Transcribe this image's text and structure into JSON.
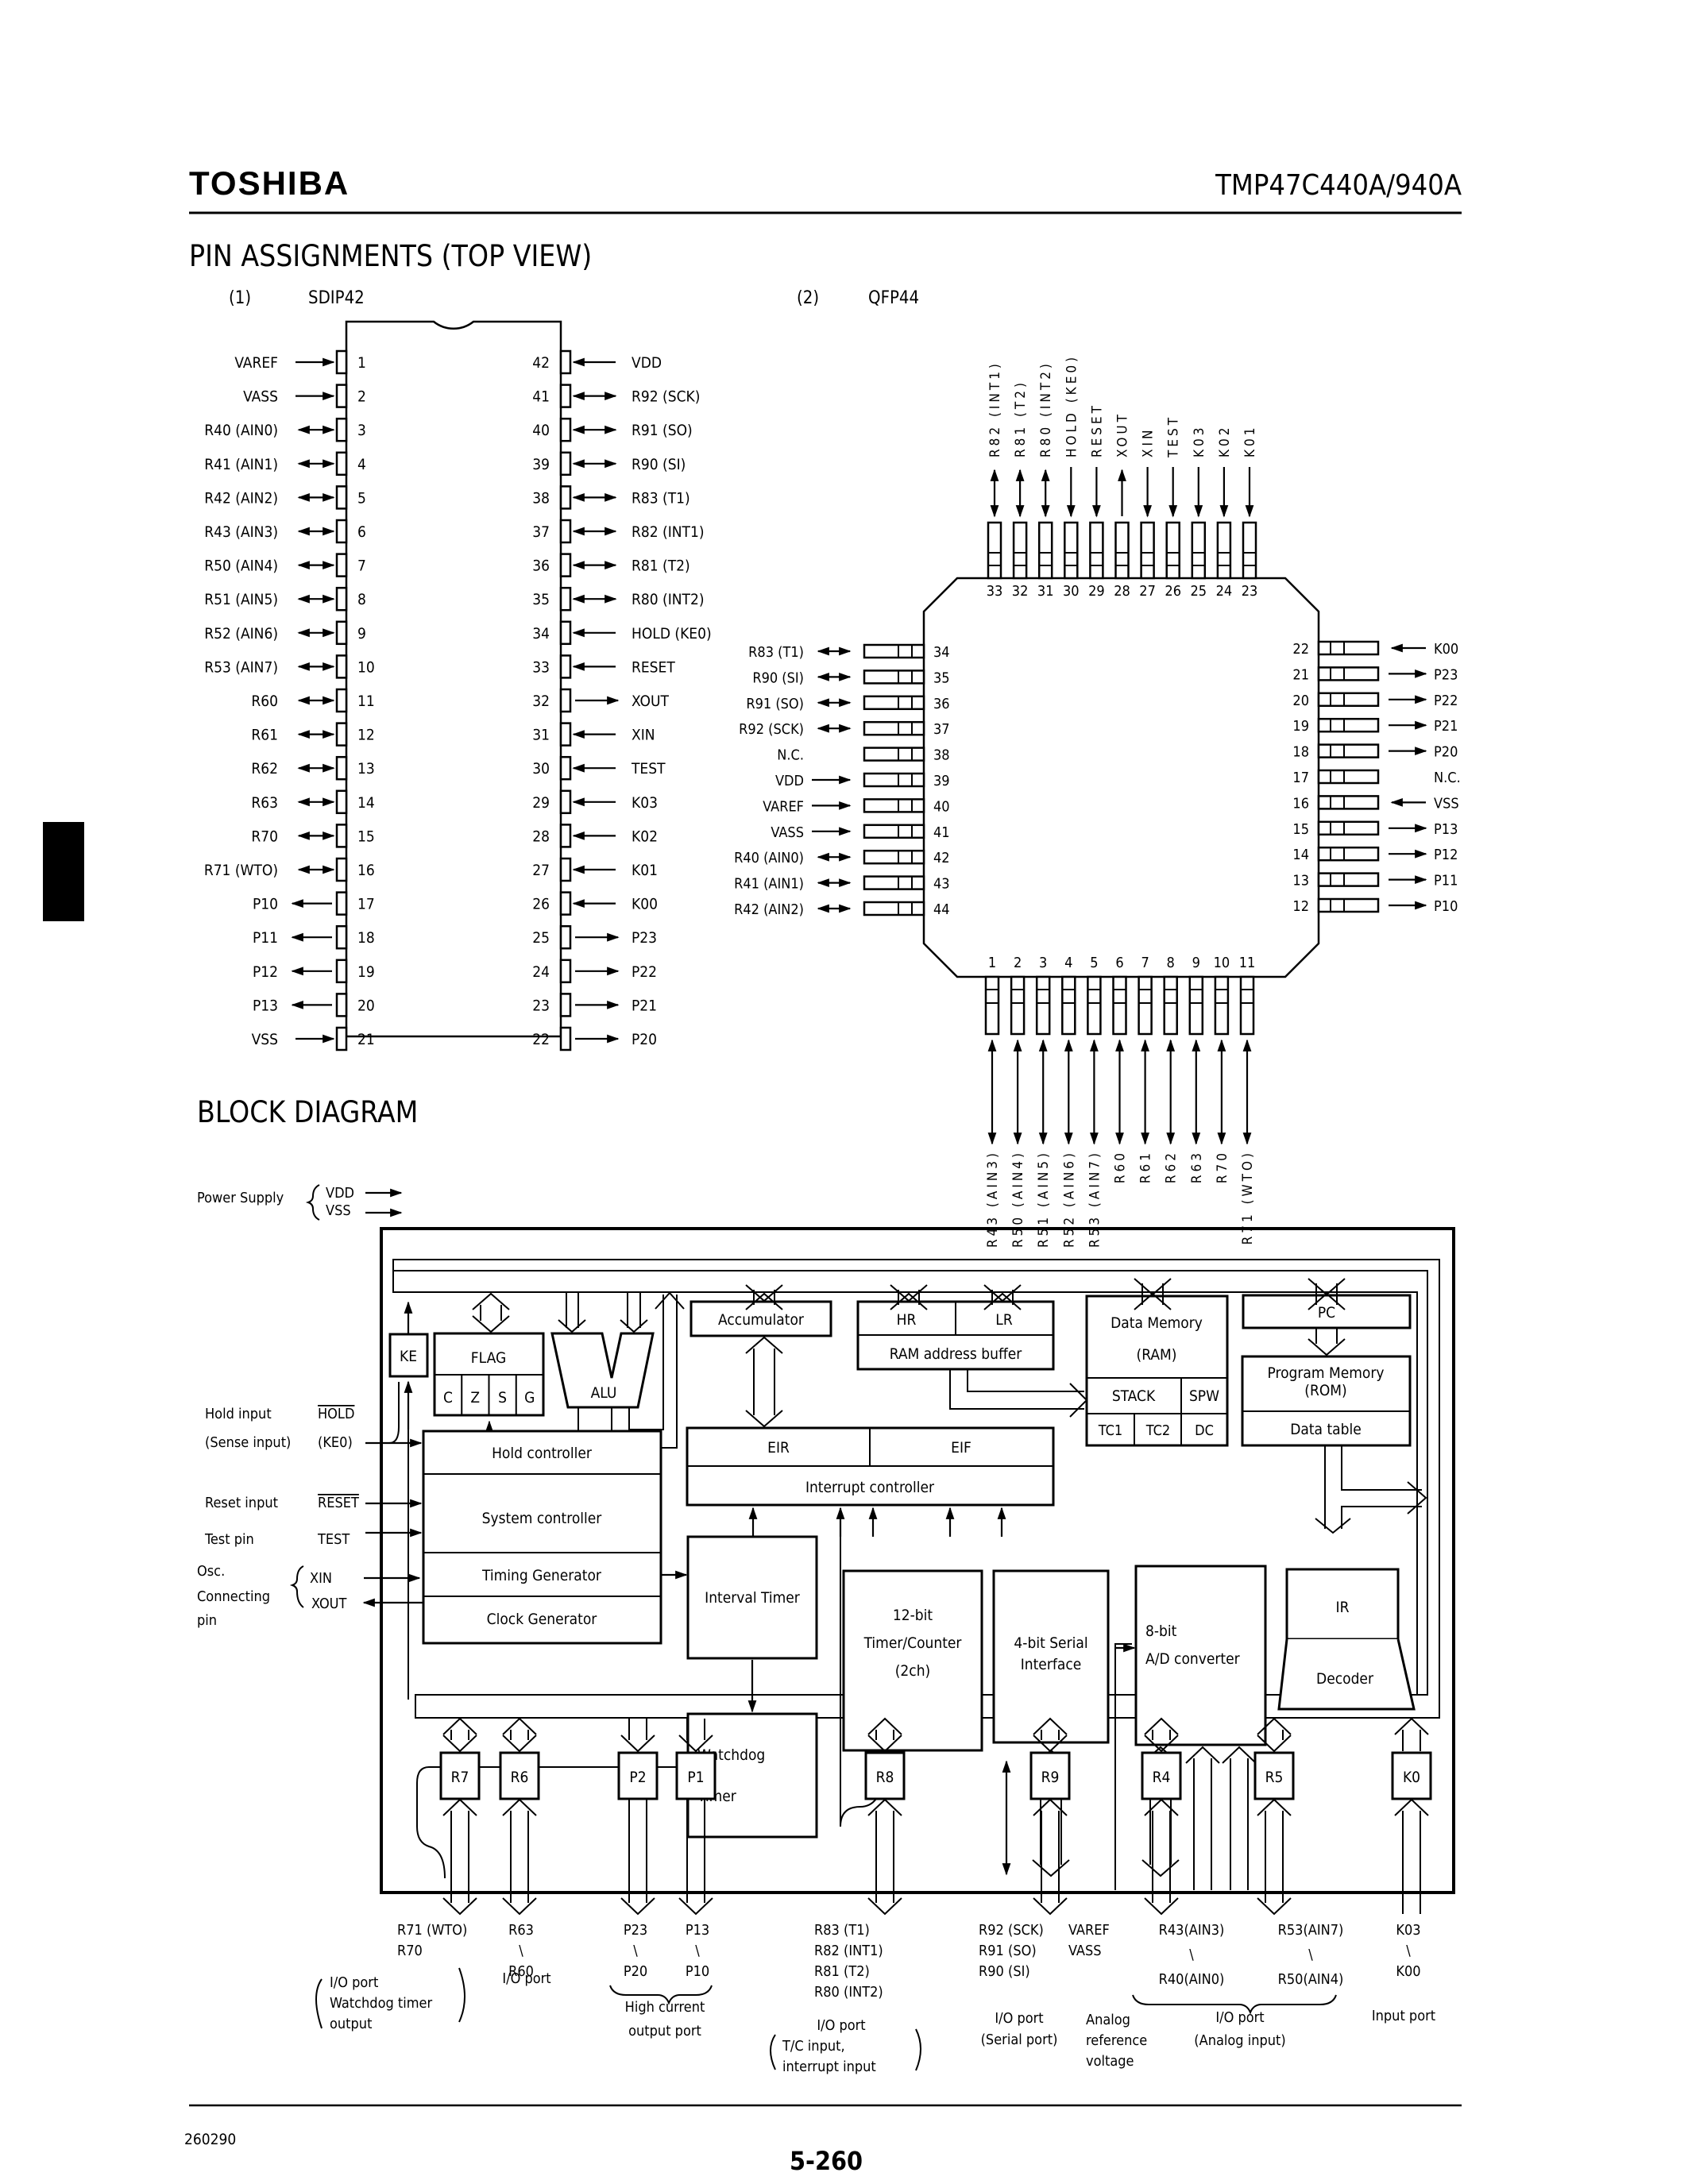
{
  "header": {
    "brand": "TOSHIBA",
    "part_number": "TMP47C440A/940A"
  },
  "pin_section": {
    "title": "PIN ASSIGNMENTS (TOP VIEW)",
    "sdip": {
      "index": "(1)",
      "name": "SDIP42",
      "left_pins": [
        {
          "num": "1",
          "label": "VAREF",
          "dir": "in"
        },
        {
          "num": "2",
          "label": "VASS",
          "dir": "in"
        },
        {
          "num": "3",
          "label": "R40 (AIN0)",
          "dir": "bi"
        },
        {
          "num": "4",
          "label": "R41 (AIN1)",
          "dir": "bi"
        },
        {
          "num": "5",
          "label": "R42 (AIN2)",
          "dir": "bi"
        },
        {
          "num": "6",
          "label": "R43 (AIN3)",
          "dir": "bi"
        },
        {
          "num": "7",
          "label": "R50 (AIN4)",
          "dir": "bi"
        },
        {
          "num": "8",
          "label": "R51 (AIN5)",
          "dir": "bi"
        },
        {
          "num": "9",
          "label": "R52 (AIN6)",
          "dir": "bi"
        },
        {
          "num": "10",
          "label": "R53 (AIN7)",
          "dir": "bi"
        },
        {
          "num": "11",
          "label": "R60",
          "dir": "bi"
        },
        {
          "num": "12",
          "label": "R61",
          "dir": "bi"
        },
        {
          "num": "13",
          "label": "R62",
          "dir": "bi"
        },
        {
          "num": "14",
          "label": "R63",
          "dir": "bi"
        },
        {
          "num": "15",
          "label": "R70",
          "dir": "bi"
        },
        {
          "num": "16",
          "label": "R71 (WTO)",
          "dir": "bi"
        },
        {
          "num": "17",
          "label": "P10",
          "dir": "out"
        },
        {
          "num": "18",
          "label": "P11",
          "dir": "out"
        },
        {
          "num": "19",
          "label": "P12",
          "dir": "out"
        },
        {
          "num": "20",
          "label": "P13",
          "dir": "out"
        },
        {
          "num": "21",
          "label": "VSS",
          "dir": "in"
        }
      ],
      "right_pins": [
        {
          "num": "42",
          "label": "VDD",
          "dir": "in"
        },
        {
          "num": "41",
          "label": "R92 (SCK)",
          "dir": "bi"
        },
        {
          "num": "40",
          "label": "R91 (SO)",
          "dir": "bi"
        },
        {
          "num": "39",
          "label": "R90 (SI)",
          "dir": "bi"
        },
        {
          "num": "38",
          "label": "R83 (T1)",
          "dir": "bi"
        },
        {
          "num": "37",
          "label": "R82 (INT1)",
          "dir": "bi"
        },
        {
          "num": "36",
          "label": "R81 (T2)",
          "dir": "bi"
        },
        {
          "num": "35",
          "label": "R80 (INT2)",
          "dir": "bi"
        },
        {
          "num": "34",
          "label": "HOLD (KE0)",
          "dir": "in"
        },
        {
          "num": "33",
          "label": "RESET",
          "dir": "in"
        },
        {
          "num": "32",
          "label": "XOUT",
          "dir": "out"
        },
        {
          "num": "31",
          "label": "XIN",
          "dir": "in"
        },
        {
          "num": "30",
          "label": "TEST",
          "dir": "in"
        },
        {
          "num": "29",
          "label": "K03",
          "dir": "in"
        },
        {
          "num": "28",
          "label": "K02",
          "dir": "in"
        },
        {
          "num": "27",
          "label": "K01",
          "dir": "in"
        },
        {
          "num": "26",
          "label": "K00",
          "dir": "in"
        },
        {
          "num": "25",
          "label": "P23",
          "dir": "out"
        },
        {
          "num": "24",
          "label": "P22",
          "dir": "out"
        },
        {
          "num": "23",
          "label": "P21",
          "dir": "out"
        },
        {
          "num": "22",
          "label": "P20",
          "dir": "out"
        }
      ]
    },
    "qfp": {
      "index": "(2)",
      "name": "QFP44",
      "top_pins": [
        {
          "num": "33",
          "label": "R82 (INT1)",
          "dir": "bi"
        },
        {
          "num": "32",
          "label": "R81 (T2)",
          "dir": "bi"
        },
        {
          "num": "31",
          "label": "R80 (INT2)",
          "dir": "bi"
        },
        {
          "num": "30",
          "label": "HOLD (KE0)",
          "dir": "in"
        },
        {
          "num": "29",
          "label": "RESET",
          "dir": "in"
        },
        {
          "num": "28",
          "label": "XOUT",
          "dir": "out"
        },
        {
          "num": "27",
          "label": "XIN",
          "dir": "in"
        },
        {
          "num": "26",
          "label": "TEST",
          "dir": "in"
        },
        {
          "num": "25",
          "label": "K03",
          "dir": "in"
        },
        {
          "num": "24",
          "label": "K02",
          "dir": "in"
        },
        {
          "num": "23",
          "label": "K01",
          "dir": "in"
        }
      ],
      "left_pins": [
        {
          "num": "34",
          "label": "R83 (T1)",
          "dir": "bi"
        },
        {
          "num": "35",
          "label": "R90 (SI)",
          "dir": "bi"
        },
        {
          "num": "36",
          "label": "R91 (SO)",
          "dir": "bi"
        },
        {
          "num": "37",
          "label": "R92 (SCK)",
          "dir": "bi"
        },
        {
          "num": "38",
          "label": "N.C.",
          "dir": "none"
        },
        {
          "num": "39",
          "label": "VDD",
          "dir": "in"
        },
        {
          "num": "40",
          "label": "VAREF",
          "dir": "in"
        },
        {
          "num": "41",
          "label": "VASS",
          "dir": "in"
        },
        {
          "num": "42",
          "label": "R40 (AIN0)",
          "dir": "bi"
        },
        {
          "num": "43",
          "label": "R41 (AIN1)",
          "dir": "bi"
        },
        {
          "num": "44",
          "label": "R42 (AIN2)",
          "dir": "bi"
        }
      ],
      "right_pins": [
        {
          "num": "22",
          "label": "K00",
          "dir": "in"
        },
        {
          "num": "21",
          "label": "P23",
          "dir": "out"
        },
        {
          "num": "20",
          "label": "P22",
          "dir": "out"
        },
        {
          "num": "19",
          "label": "P21",
          "dir": "out"
        },
        {
          "num": "18",
          "label": "P20",
          "dir": "out"
        },
        {
          "num": "17",
          "label": "N.C.",
          "dir": "none"
        },
        {
          "num": "16",
          "label": "VSS",
          "dir": "in"
        },
        {
          "num": "15",
          "label": "P13",
          "dir": "out"
        },
        {
          "num": "14",
          "label": "P12",
          "dir": "out"
        },
        {
          "num": "13",
          "label": "P11",
          "dir": "out"
        },
        {
          "num": "12",
          "label": "P10",
          "dir": "out"
        }
      ],
      "bottom_pins": [
        {
          "num": "1",
          "label": "R43 (AIN3)",
          "dir": "bi"
        },
        {
          "num": "2",
          "label": "R50 (AIN4)",
          "dir": "bi"
        },
        {
          "num": "3",
          "label": "R51 (AIN5)",
          "dir": "bi"
        },
        {
          "num": "4",
          "label": "R52 (AIN6)",
          "dir": "bi"
        },
        {
          "num": "5",
          "label": "R53 (AIN7)",
          "dir": "bi"
        },
        {
          "num": "6",
          "label": "R60",
          "dir": "bi"
        },
        {
          "num": "7",
          "label": "R61",
          "dir": "bi"
        },
        {
          "num": "8",
          "label": "R62",
          "dir": "bi"
        },
        {
          "num": "9",
          "label": "R63",
          "dir": "bi"
        },
        {
          "num": "10",
          "label": "R70",
          "dir": "bi"
        },
        {
          "num": "11",
          "label": "R71 (WTO)",
          "dir": "bi"
        }
      ]
    }
  },
  "block_diagram": {
    "title": "BLOCK DIAGRAM",
    "inputs": {
      "power_supply": "Power Supply",
      "vdd": "VDD",
      "vss": "VSS",
      "hold_input": "Hold input",
      "hold": "HOLD",
      "sense_input": "(Sense input)",
      "ke0": "(KE0)",
      "reset_input": "Reset input",
      "reset": "RESET",
      "test_pin": "Test pin",
      "test": "TEST",
      "osc1": "Osc.",
      "osc2": "Connecting",
      "osc3": "pin",
      "xin": "XIN",
      "xout": "XOUT"
    },
    "blocks": {
      "ke": "KE",
      "flag": "FLAG",
      "flag_bits": [
        "C",
        "Z",
        "S",
        "G"
      ],
      "alu": "ALU",
      "accumulator": "Accumulator",
      "hr": "HR",
      "lr": "LR",
      "ram_addr": "RAM address buffer",
      "data_memory_1": "Data Memory",
      "data_memory_2": "(RAM)",
      "stack": "STACK",
      "spw": "SPW",
      "tc1": "TC1",
      "tc2": "TC2",
      "dc": "DC",
      "pc": "PC",
      "program_memory_1": "Program Memory",
      "program_memory_2": "(ROM)",
      "data_table": "Data table",
      "eir": "EIR",
      "eif": "EIF",
      "interrupt_controller": "Interrupt controller",
      "hold_controller": "Hold controller",
      "system_controller": "System controller",
      "timing_generator": "Timing Generator",
      "clock_generator": "Clock Generator",
      "interval_timer": "Interval Timer",
      "watchdog_1": "Watchdog",
      "watchdog_2": "Timer",
      "timer_1": "12-bit",
      "timer_2": "Timer/Counter",
      "timer_3": "(2ch)",
      "serial_1": "4-bit Serial",
      "serial_2": "Interface",
      "adc_1": "8-bit",
      "adc_2": "A/D converter",
      "ir": "IR",
      "decoder": "Decoder"
    },
    "ports": [
      "R7",
      "R6",
      "P2",
      "P1",
      "R8",
      "R9",
      "R4",
      "R5",
      "K0"
    ],
    "port_labels": {
      "r7": [
        "R71 (WTO)",
        "R70"
      ],
      "r6": [
        "R63",
        "\\",
        "R60"
      ],
      "p2": [
        "P23",
        "\\",
        "P20"
      ],
      "p1": [
        "P13",
        "\\",
        "P10"
      ],
      "r8": [
        "R83 (T1)",
        "R82 (INT1)",
        "R81 (T2)",
        "R80 (INT2)"
      ],
      "r9": [
        "R92 (SCK)",
        "R91 (SO)",
        "R90 (SI)"
      ],
      "vref": [
        "VAREF",
        "VASS"
      ],
      "r4": [
        "R43(AIN3)",
        "\\",
        "R40(AIN0)"
      ],
      "r5": [
        "R53(AIN7)",
        "\\",
        "R50(AIN4)"
      ],
      "k0": [
        "K03",
        "\\",
        "K00"
      ]
    },
    "port_notes": {
      "r7": [
        "I/O port",
        "Watchdog timer",
        "output"
      ],
      "r6": [
        "I/O port"
      ],
      "p": [
        "High current",
        "output port"
      ],
      "r8": [
        "I/O port",
        "T/C input,",
        "interrupt input"
      ],
      "r9": [
        "I/O port",
        "(Serial port)"
      ],
      "vref": [
        "Analog",
        "reference",
        "voltage"
      ],
      "r45": [
        "I/O port",
        "(Analog input)"
      ],
      "k0": [
        "Input port"
      ]
    }
  },
  "footer": {
    "code": "260290",
    "page": "5-260"
  }
}
